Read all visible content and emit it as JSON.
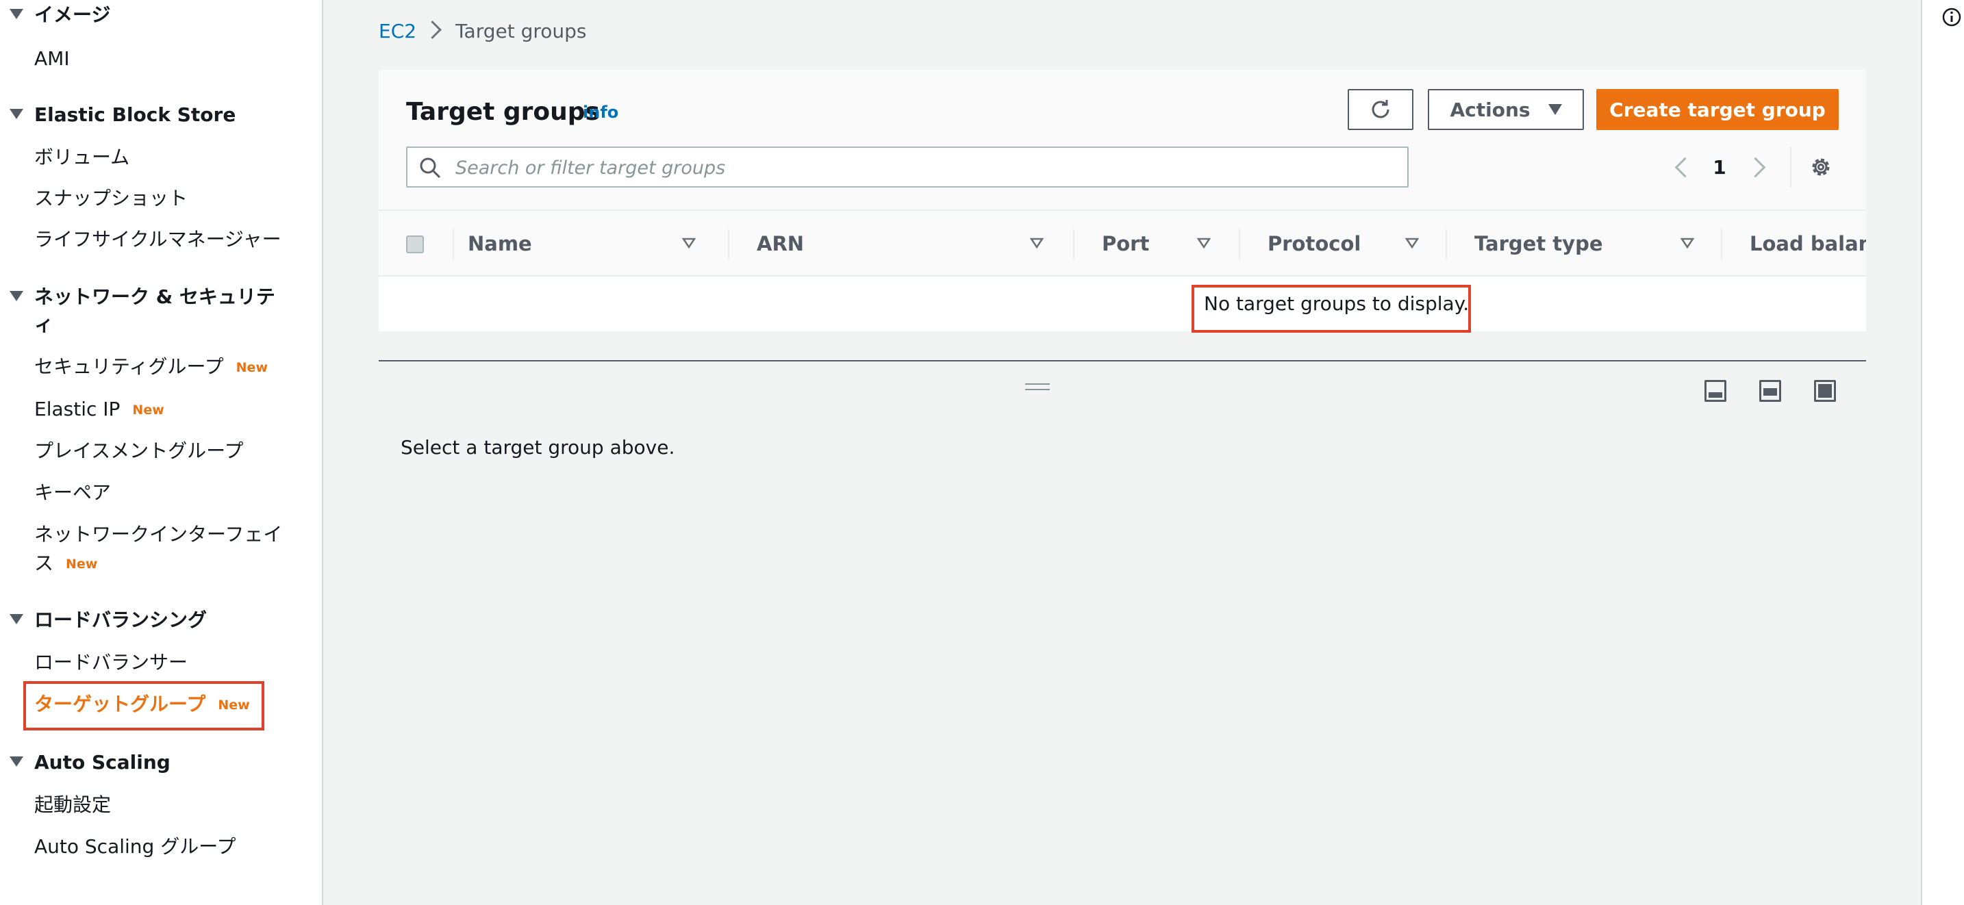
{
  "sidebar": {
    "sections": [
      {
        "title": "イメージ",
        "items": [
          {
            "label": "AMI"
          }
        ]
      },
      {
        "title": "Elastic Block Store",
        "items": [
          {
            "label": "ボリューム"
          },
          {
            "label": "スナップショット"
          },
          {
            "label": "ライフサイクルマネージャー"
          }
        ]
      },
      {
        "title_line1": "ネットワーク & セキュリテ",
        "title_line2": "ィ",
        "items": [
          {
            "label": "セキュリティグループ",
            "badge": "New"
          },
          {
            "label": "Elastic IP",
            "badge": "New"
          },
          {
            "label": "プレイスメントグループ"
          },
          {
            "label": "キーペア"
          },
          {
            "label_line1": "ネットワークインターフェイ",
            "label_line2": "ス",
            "badge": "New"
          }
        ]
      },
      {
        "title": "ロードバランシング",
        "items": [
          {
            "label": "ロードバランサー"
          },
          {
            "label": "ターゲットグループ",
            "badge": "New",
            "active": true
          }
        ]
      },
      {
        "title": "Auto Scaling",
        "items": [
          {
            "label": "起動設定"
          },
          {
            "label": "Auto Scaling グループ"
          }
        ]
      }
    ]
  },
  "breadcrumb": {
    "root": "EC2",
    "current": "Target groups"
  },
  "panel": {
    "title": "Target groups",
    "info": "info",
    "actions_label": "Actions",
    "create_label": "Create target group",
    "search_placeholder": "Search or filter target groups",
    "page_number": "1",
    "columns": [
      "Name",
      "ARN",
      "Port",
      "Protocol",
      "Target type",
      "Load balance"
    ],
    "empty_message": "No target groups to display."
  },
  "detail": {
    "message": "Select a target group above."
  },
  "colors": {
    "accent": "#ec7211",
    "link": "#0073bb",
    "highlight": "#e0412b"
  },
  "icons": [
    "refresh-icon",
    "dropdown-caret-icon",
    "search-icon",
    "chevron-left-icon",
    "chevron-right-icon",
    "gear-icon",
    "sort-icon",
    "drag-handle-icon",
    "layout-bottom-icon",
    "layout-split-icon",
    "layout-full-icon",
    "info-icon",
    "caret-down-icon"
  ]
}
